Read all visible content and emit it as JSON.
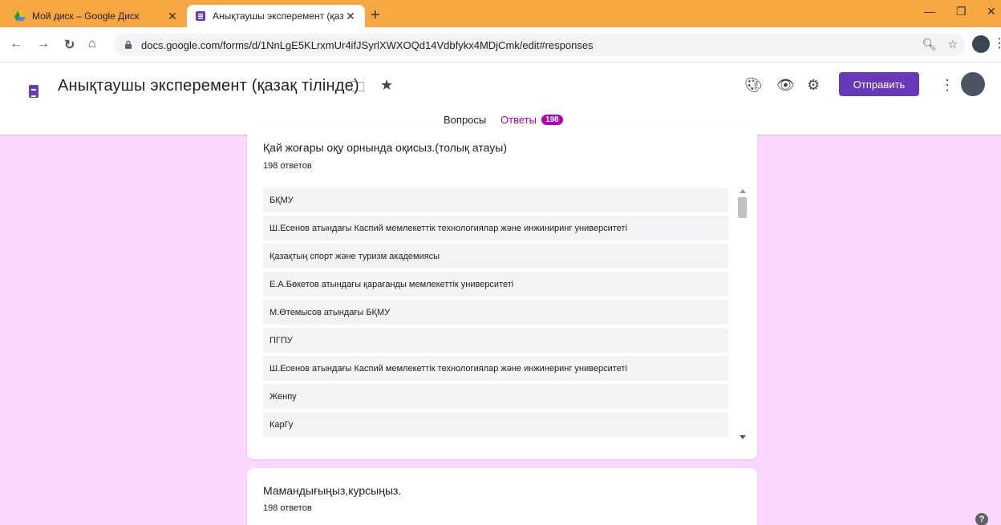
{
  "browser": {
    "tabs": [
      {
        "title": "Мой диск – Google Диск"
      },
      {
        "title": "Анықтаушы эксперемент (қазақ тілінде)"
      }
    ],
    "url": "docs.google.com/forms/d/1NnLgE5KLrxmUr4ifJSyrlXWXOQd14Vdbfykx4MDjCmk/edit#responses"
  },
  "form": {
    "title": "Анықтаушы эксперемент (қазақ тілінде)",
    "send_label": "Отправить",
    "tabs": {
      "questions": "Вопросы",
      "answers": "Ответы",
      "answers_count": "198"
    }
  },
  "questions": [
    {
      "title": "Қай жоғары оқу орнында оқисыз.(толық атауы)",
      "count": "198 ответов",
      "responses": [
        "БҚМУ",
        "Ш.Есенов атындағы Каспий мемлекеттік технологиялар және инжиниринг университеті",
        "Қазақтың спорт және туризм академиясы",
        "Е.А.Бөкетов атындағы қарағанды мемлекеттік университеті",
        "М.Өтемысов атындағы БҚМУ",
        "ПГПУ",
        "Ш.Есенов атындағы Каспий мемлекеттік технологиялар және инжинеринг университеті",
        "Женпу",
        "КарГу"
      ]
    },
    {
      "title": "Мамандығыңыз,курсыңыз.",
      "count": "198 ответов"
    }
  ],
  "colors": {
    "accent": "#673ab7",
    "answers_tab": "#b000b8",
    "page_bg": "#fdd8fd",
    "tabstrip": "#f6a742"
  }
}
